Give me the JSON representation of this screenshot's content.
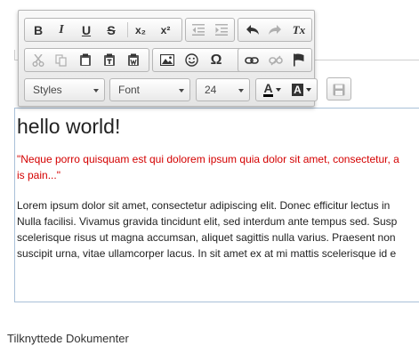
{
  "toolbar": {
    "icons": {
      "bold": "B",
      "italic": "I",
      "underline": "U",
      "strike": "S",
      "subscript": "x₂",
      "superscript": "x²",
      "remove_format": "Tx",
      "special_char": "Ω",
      "text_color": "A",
      "bg_color": "A"
    },
    "styles_label": "Styles",
    "font_label": "Font",
    "size_value": "24"
  },
  "editor": {
    "heading": "hello world!",
    "quote_line1": "\"Neque porro quisquam est qui dolorem ipsum quia dolor sit amet, consectetur, a",
    "quote_line2": "is pain...\"",
    "body_lines": [
      "Lorem ipsum dolor sit amet, consectetur adipiscing elit. Donec efficitur lectus in",
      "Nulla facilisi. Vivamus gravida tincidunt elit, sed interdum ante tempus sed. Susp",
      "scelerisque risus ut magna accumsan, aliquet sagittis nulla varius. Praesent non",
      "suscipit urna, vitae ullamcorper lacus. In sit amet ex at mi mattis scelerisque id e"
    ],
    "quote_color": "#d40000"
  },
  "section_title": "Tilknyttede Dokumenter"
}
